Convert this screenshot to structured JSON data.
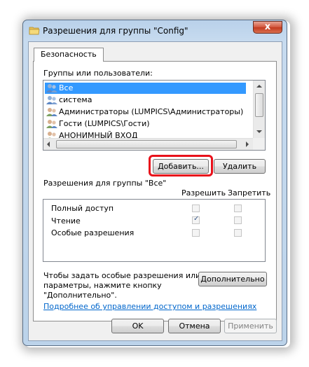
{
  "window": {
    "title": "Разрешения для группы \"Config\"",
    "close_glyph": "x"
  },
  "tabs": [
    {
      "label": "Безопасность"
    }
  ],
  "groups_section": {
    "label": "Группы или пользователи:",
    "items": [
      {
        "label": "Все",
        "selected": true
      },
      {
        "label": "система",
        "selected": false
      },
      {
        "label": "Администраторы (LUMPICS\\Администраторы)",
        "selected": false
      },
      {
        "label": "Гости (LUMPICS\\Гости)",
        "selected": false
      },
      {
        "label": "АНОНИМНЫЙ ВХОД",
        "selected": false
      }
    ]
  },
  "buttons": {
    "add": "Добавить...",
    "remove": "Удалить",
    "advanced": "Дополнительно",
    "ok": "OK",
    "cancel": "Отмена",
    "apply": "Применить"
  },
  "permissions": {
    "label": "Разрешения для группы \"Все\"",
    "col_allow": "Разрешить",
    "col_deny": "Запретить",
    "rows": [
      {
        "label": "Полный доступ",
        "allow": false,
        "deny": false
      },
      {
        "label": "Чтение",
        "allow": true,
        "deny": false
      },
      {
        "label": "Особые разрешения",
        "allow": false,
        "deny": false
      }
    ]
  },
  "advanced_note": {
    "line1": "Чтобы задать особые разрешения или",
    "line2": "параметры, нажмите кнопку",
    "line3": "\"Дополнительно\"."
  },
  "help_link": "Подробнее об управлении доступом и разрешениях",
  "colors": {
    "selection": "#3399ff",
    "highlight_frame": "#e8111b",
    "link": "#0066cc"
  }
}
